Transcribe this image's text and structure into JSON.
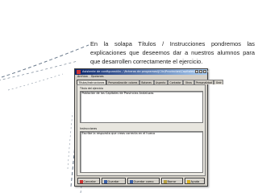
{
  "caption": {
    "text": "En la solapa Títulos / Instrucciones pondremos las explicaciones que deseemos dar a nuestros alumnos para que desarrollen correctamente el ejercicio."
  },
  "window": {
    "title": "Asistente de configuración - \\ficheros de programas\\JClic\\Provincias\\Capitales\\Capitales.cfg",
    "menu": [
      "Archivo",
      "Opciones"
    ],
    "tabs": [
      "Títulos/Instrucciones",
      "Personalización colores",
      "Botones",
      "Aspecto",
      "Contador",
      "Otros",
      "Personalidad",
      "Ordr"
    ],
    "active_tab_index": 0,
    "exercise_title_label": "Título del ejercicio",
    "exercise_title_value": "Población de las Capitales de Provincias Andaluzas",
    "instructions_label": "Instrucciones",
    "instructions_value": "Escribe la respuesta que creas correcta en el hueco",
    "buttons": {
      "cancel": "Cancelar",
      "save": "Guardar",
      "save_as": "Guardar como",
      "clear": "Borrar",
      "help": "Ayuda"
    }
  },
  "colors": {
    "titlebar_start": "#0a246a",
    "window_face": "#d4d0c8",
    "deco_stroke": "#6a7a8c"
  }
}
